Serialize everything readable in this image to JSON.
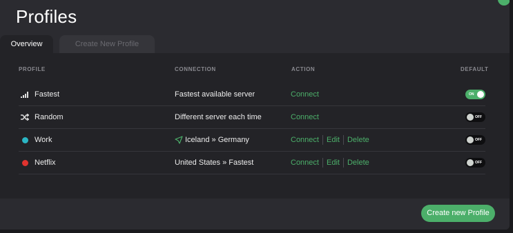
{
  "window": {
    "title": "Profiles"
  },
  "tabs": [
    {
      "label": "Overview",
      "active": true
    },
    {
      "label": "Create New Profile",
      "active": false
    }
  ],
  "table": {
    "headers": {
      "profile": "PROFILE",
      "connection": "CONNECTION",
      "action": "ACTION",
      "default": "DEFAULT"
    },
    "rows": [
      {
        "name": "Fastest",
        "icon": "signal-bars-icon",
        "connection": "Fastest available server",
        "connection_icon": "",
        "actions": [
          "Connect"
        ],
        "toggle": "ON",
        "toggle_on": true
      },
      {
        "name": "Random",
        "icon": "shuffle-icon",
        "connection": "Different server each time",
        "connection_icon": "",
        "actions": [
          "Connect"
        ],
        "toggle": "OFF",
        "toggle_on": false
      },
      {
        "name": "Work",
        "icon": "teal-dot-icon",
        "icon_color": "#2bb6c4",
        "connection": "Iceland » Germany",
        "connection_icon": "route-arrow-icon",
        "actions": [
          "Connect",
          "Edit",
          "Delete"
        ],
        "toggle": "OFF",
        "toggle_on": false
      },
      {
        "name": "Netflix",
        "icon": "red-dot-icon",
        "icon_color": "#e0332f",
        "connection": "United States » Fastest",
        "connection_icon": "",
        "actions": [
          "Connect",
          "Edit",
          "Delete"
        ],
        "toggle": "OFF",
        "toggle_on": false
      }
    ]
  },
  "footer": {
    "create_button": "Create new Profile"
  },
  "colors": {
    "accent": "#4caf6a",
    "background": "#2b2b30",
    "panel": "#232327"
  }
}
